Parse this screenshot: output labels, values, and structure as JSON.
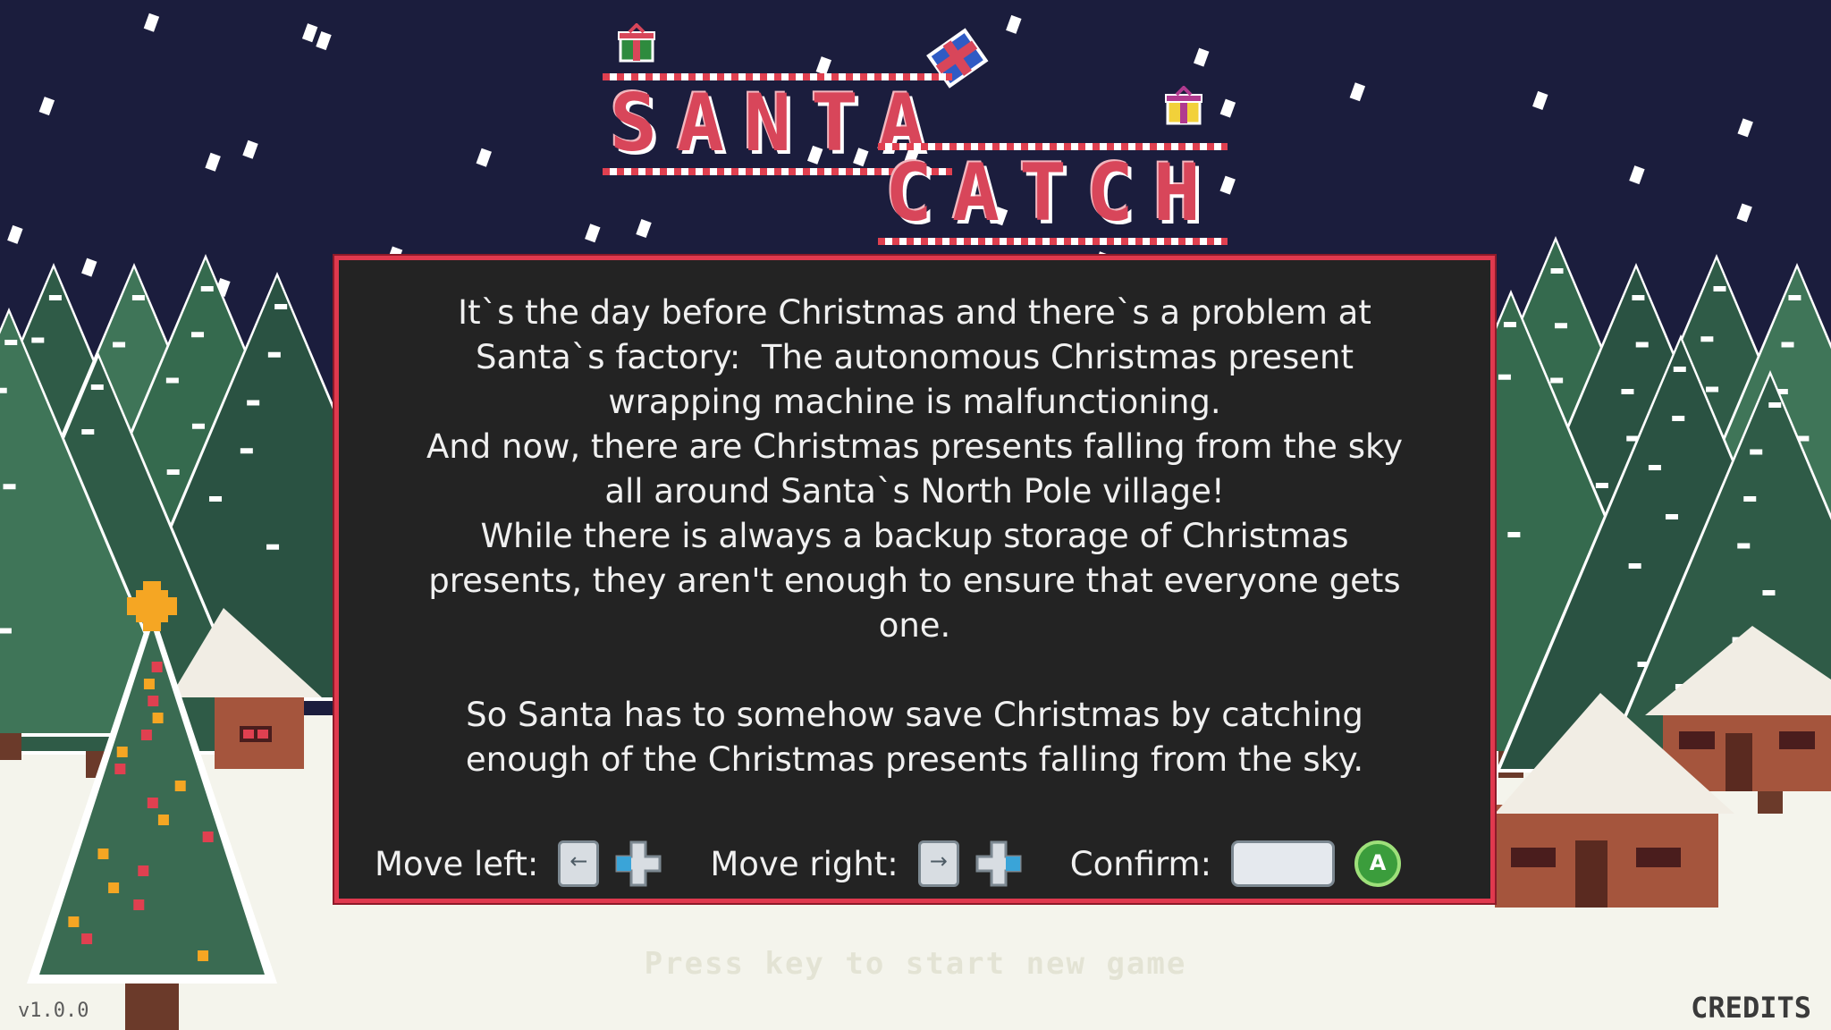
{
  "game": {
    "title_line1": "SANTA",
    "title_line2": "CATCH"
  },
  "story": {
    "text": "It`s the day before Christmas and there`s a problem at\nSanta`s factory:  The autonomous Christmas present\nwrapping machine is malfunctioning.\nAnd now, there are Christmas presents falling from the sky\nall around Santa`s North Pole village!\nWhile there is always a backup storage of Christmas\npresents, they aren't enough to ensure that everyone gets\none.\n\nSo Santa has to somehow save Christmas by catching\nenough of the Christmas presents falling from the sky."
  },
  "controls": {
    "move_left_label": "Move left:",
    "move_right_label": "Move right:",
    "confirm_label": "Confirm:",
    "gamepad_a": "A"
  },
  "footer": {
    "press_start": "Press key to start new game",
    "version": "v1.0.0",
    "credits": "CREDITS"
  },
  "colors": {
    "sky": "#1b1d3d",
    "snow": "#f4f4ec",
    "panel_bg": "#232323",
    "panel_border": "#e0394e",
    "title_red": "#d8465a",
    "pine_dark": "#2f5b47",
    "pine_mid": "#3f7558",
    "cabin_wood": "#a5553d"
  },
  "icons": [
    "gift-red-icon",
    "gift-blue-icon",
    "gift-yellow-icon",
    "left-arrow-key-icon",
    "dpad-left-icon",
    "right-arrow-key-icon",
    "dpad-right-icon",
    "space-key-icon",
    "gamepad-a-button-icon"
  ]
}
